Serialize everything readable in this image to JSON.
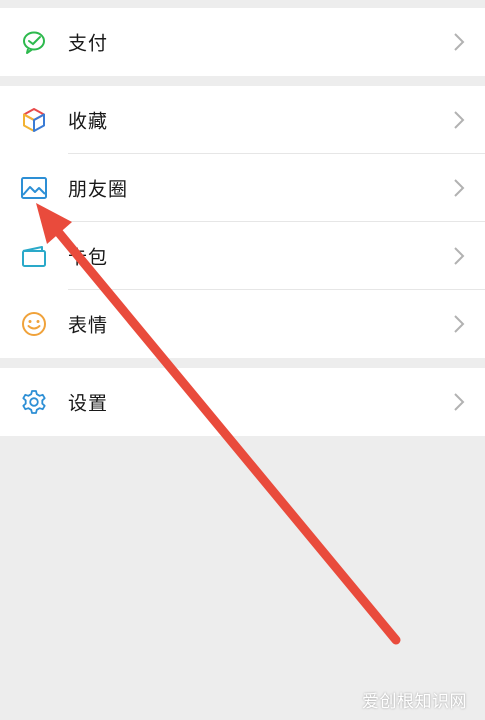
{
  "menu": {
    "pay": {
      "label": "支付",
      "icon": "wechat-pay-icon"
    },
    "favorites": {
      "label": "收藏",
      "icon": "cube-icon"
    },
    "moments": {
      "label": "朋友圈",
      "icon": "image-icon"
    },
    "cards": {
      "label": "卡包",
      "icon": "card-icon"
    },
    "stickers": {
      "label": "表情",
      "icon": "smiley-icon"
    },
    "settings": {
      "label": "设置",
      "icon": "gear-icon"
    }
  },
  "watermark": "爱创根知识网",
  "colors": {
    "background": "#ededed",
    "row_background": "#ffffff",
    "pay_green": "#2db94d",
    "moments_blue": "#2d8fd5",
    "stickers_orange": "#f0a23a",
    "annotation_arrow": "#e94b3c"
  }
}
